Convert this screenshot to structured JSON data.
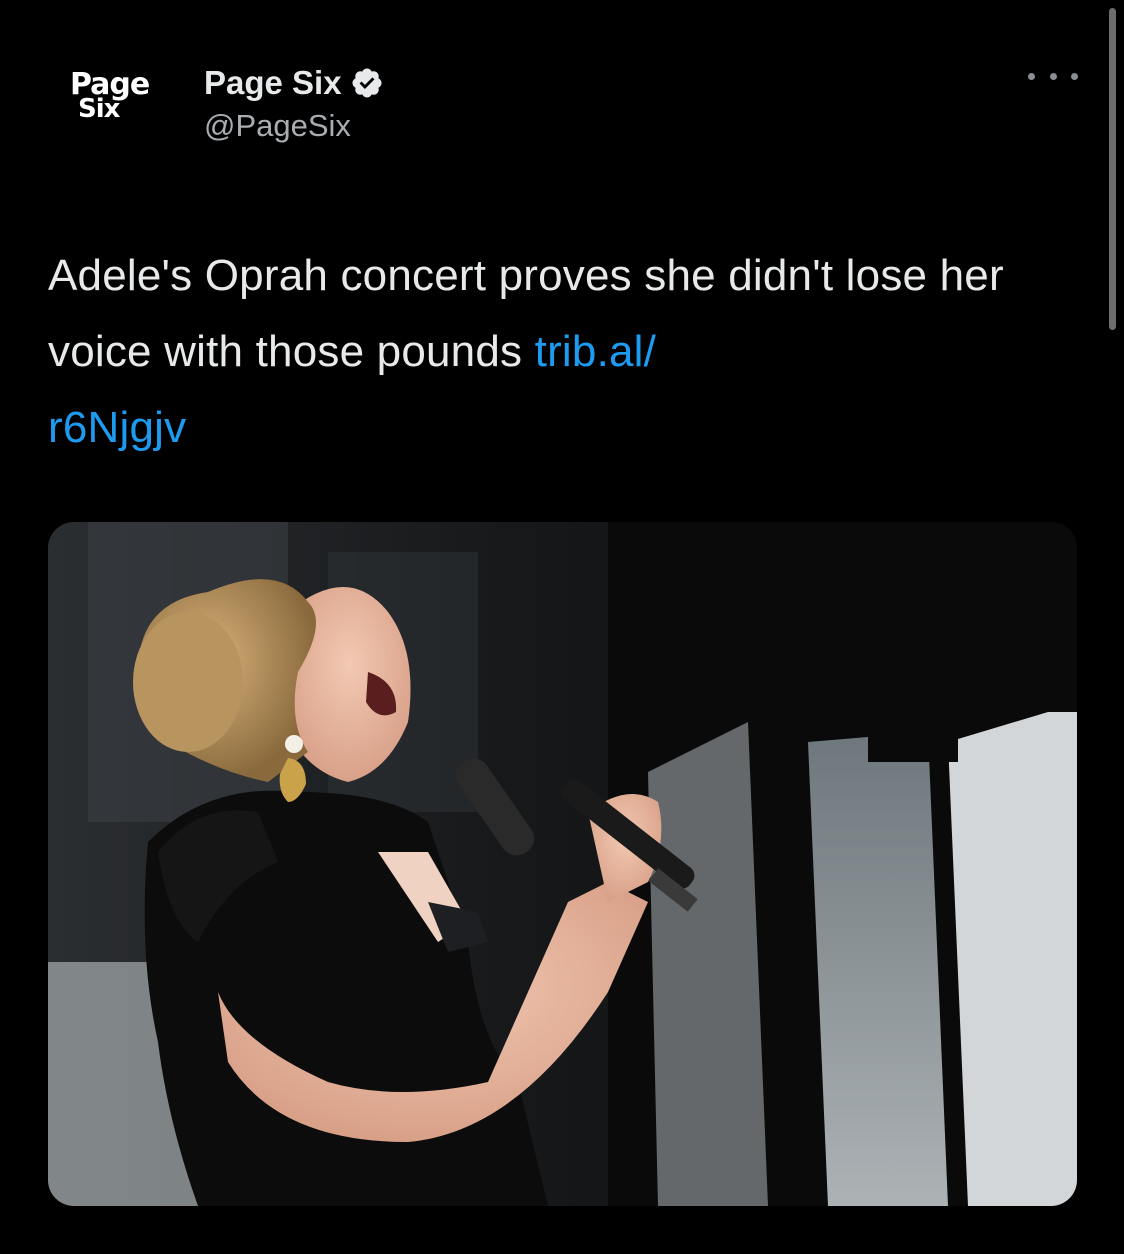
{
  "tweet": {
    "author": {
      "avatar_logo_lines": [
        "Page",
        "Six"
      ],
      "display_name": "Page Six",
      "verified": true,
      "handle": "@PageSix"
    },
    "more_icon": "more-horizontal-icon",
    "text": "Adele's Oprah concert proves she didn't lose her voice with those pounds ",
    "link_text_line1": "trib.al/",
    "link_text_line2": "r6Njgjv",
    "media": {
      "type": "photo",
      "icon": "photo-of-singer-with-microphone"
    }
  },
  "colors": {
    "background": "#000000",
    "text": "#e7e9ea",
    "secondary_text": "#a8adb2",
    "link": "#1d9bf0",
    "verified_badge": "#e7e9ea"
  }
}
